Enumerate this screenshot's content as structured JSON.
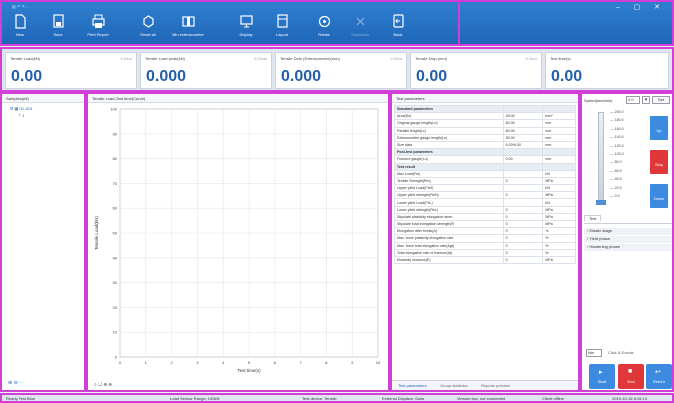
{
  "ribbon": {
    "quick_access": "▤ ↶ ↷ …",
    "items": [
      {
        "label": "New",
        "icon": "new-document-icon"
      },
      {
        "label": "Save",
        "icon": "save-icon"
      },
      {
        "label": "Print Report",
        "icon": "printer-icon"
      },
      {
        "label": "Reset all",
        "icon": "reset-icon"
      },
      {
        "label": "Min extensometer",
        "icon": "extensometer-icon"
      },
      {
        "label": "Display",
        "icon": "display-icon"
      },
      {
        "label": "Layout",
        "icon": "layout-icon"
      },
      {
        "label": "Rotate",
        "icon": "rotate-icon"
      },
      {
        "label": "Shutdown",
        "icon": "shutdown-icon"
      },
      {
        "label": "Back",
        "icon": "back-icon"
      }
    ]
  },
  "readouts": [
    {
      "title": "Tensile Load(kN)",
      "zero": "0 Zero",
      "value": "0.00"
    },
    {
      "title": "Tensile Load peak(kN)",
      "zero": "0 Clear",
      "value": "0.000"
    },
    {
      "title": "Tensile Defo (Extensometer)(mm)",
      "zero": "0 Zero",
      "value": "0.000"
    },
    {
      "title": "Tensile Disp.(mm)",
      "zero": "0 Zero",
      "value": "0.00"
    },
    {
      "title": "Test time(s)",
      "zero": "",
      "value": "0.00"
    }
  ],
  "samples": {
    "header": "Samples(All)",
    "root": "GL-001",
    "child": "1"
  },
  "chart": {
    "header": "Tensile Load-Test time(Curve)",
    "xlabel": "Test time(s)",
    "ylabel": "Tensile Load(kN)",
    "toolbar": "⌕ ↺ ⊕ ⊖"
  },
  "chart_data": {
    "type": "line",
    "title": "Tensile Load-Test time(Curve)",
    "xlabel": "Test time(s)",
    "ylabel": "Tensile Load(kN)",
    "xlim": [
      0,
      10
    ],
    "ylim": [
      0,
      100
    ],
    "x_ticks": [
      "0",
      "1",
      "2",
      "3",
      "4",
      "5",
      "6",
      "7",
      "8",
      "9",
      "10"
    ],
    "y_ticks": [
      "0",
      "10",
      "20",
      "30",
      "40",
      "50",
      "60",
      "70",
      "80",
      "90",
      "100"
    ],
    "grid": true,
    "series": []
  },
  "params": {
    "header": "Test parameters",
    "rows": [
      {
        "name": "Standard parameters",
        "value": "",
        "unit": "",
        "section": true
      },
      {
        "name": "Area(So)",
        "value": "49.00",
        "unit": "mm²"
      },
      {
        "name": "Original gauge length(Lo)",
        "value": "50.00",
        "unit": "mm"
      },
      {
        "name": "Parallel length(Lc)",
        "value": "60.00",
        "unit": "mm"
      },
      {
        "name": "Extensometer gauge length(Le)",
        "value": "50.00",
        "unit": "mm"
      },
      {
        "name": "Size data",
        "value": "6.00*6.00",
        "unit": "mm"
      },
      {
        "name": "Post-test parameters",
        "value": "",
        "unit": "",
        "section": true
      },
      {
        "name": "Fracture gauge(Lu)",
        "value": "0.00",
        "unit": "mm"
      },
      {
        "name": "Test result",
        "value": "",
        "unit": "",
        "section": true
      },
      {
        "name": "Max.Load(Fm)",
        "value": "",
        "unit": "kN"
      },
      {
        "name": "Tensile Strength(Rm)",
        "value": "0",
        "unit": "MPa"
      },
      {
        "name": "Upper yield Load(FeH)",
        "value": "",
        "unit": "kN"
      },
      {
        "name": "Upper yield strength(ReH)",
        "value": "0",
        "unit": "MPa"
      },
      {
        "name": "Lower yield Load(FeL)",
        "value": "",
        "unit": "kN"
      },
      {
        "name": "Lower yield strength(ReL)",
        "value": "0",
        "unit": "MPa"
      },
      {
        "name": "Stipulate plasticity elongation stren",
        "value": "0",
        "unit": "MPa"
      },
      {
        "name": "Stipulate total elongation strength(R",
        "value": "0",
        "unit": "MPa"
      },
      {
        "name": "Elongation after break(A)",
        "value": "0",
        "unit": "%"
      },
      {
        "name": "Max. force plasticity elongation rate",
        "value": "0",
        "unit": "%"
      },
      {
        "name": "Max. force total elongation rate(Agt)",
        "value": "0",
        "unit": "%"
      },
      {
        "name": "Total elongation rate of fracture(At)",
        "value": "0",
        "unit": "%"
      },
      {
        "name": "Elasticity modulus(E)",
        "value": "0",
        "unit": "MPa"
      }
    ],
    "tabs": [
      "Test parameters",
      "Group statistics",
      "Reports preview"
    ]
  },
  "control": {
    "speed_label": "Speed(mm/min)",
    "speed_value": "2.0",
    "set_label": "Set",
    "scale": [
      "200.0",
      "180.0",
      "160.0",
      "140.0",
      "120.0",
      "100.0",
      "80.0",
      "60.0",
      "40.0",
      "20.0",
      "0.0"
    ],
    "btn_up": "Up",
    "btn_stop": "Stop",
    "btn_down": "Down",
    "tab_test": "Test",
    "stages": [
      "Elastic stage",
      "Yield phase",
      "Hardening phase"
    ],
    "footer_input": "Nm",
    "footer_link": "Click & Excute",
    "btn_start": "Start",
    "btn_end": "End",
    "btn_return": "Return"
  },
  "status": {
    "left": "Ready  Test Blue",
    "sensor": "Load Sensor Range: 100kN",
    "device": "Test device: Tensile",
    "ext": "External Displace: Data",
    "ver": "Version two, not connected",
    "state": "Client offline",
    "time": "2019-10-16 8:15:14"
  }
}
